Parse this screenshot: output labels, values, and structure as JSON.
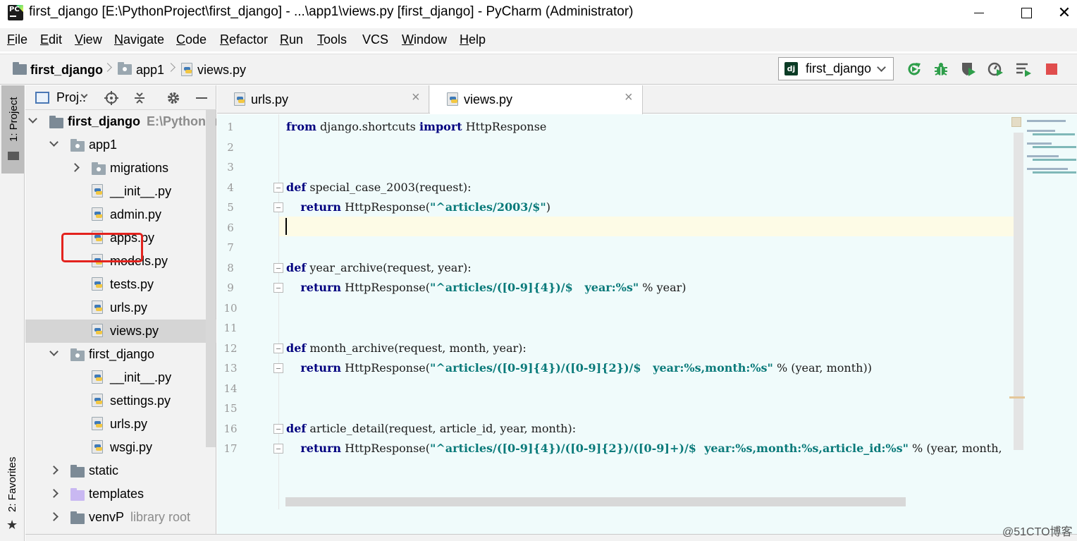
{
  "window": {
    "title": "first_django [E:\\PythonProject\\first_django] - ...\\app1\\views.py [first_django] - PyCharm (Administrator)",
    "app_icon_text": "PC",
    "close_glyph": "✕"
  },
  "menu": {
    "items": [
      {
        "mn": "F",
        "rest": "ile"
      },
      {
        "mn": "E",
        "rest": "dit"
      },
      {
        "mn": "V",
        "rest": "iew"
      },
      {
        "mn": "N",
        "rest": "avigate"
      },
      {
        "mn": "C",
        "rest": "ode"
      },
      {
        "mn": "R",
        "rest": "efactor"
      },
      {
        "mn": "R",
        "rest": "un"
      },
      {
        "mn": "T",
        "rest": "ools"
      },
      {
        "mn": "",
        "rest": "VCS"
      },
      {
        "mn": "W",
        "rest": "indow"
      },
      {
        "mn": "H",
        "rest": "elp"
      }
    ]
  },
  "breadcrumbs": [
    "first_django",
    "app1",
    "views.py"
  ],
  "run_config": {
    "icon_text": "dj",
    "label": "first_django"
  },
  "toolbar_icons": [
    "rerun-icon",
    "debug-icon",
    "coverage-icon",
    "profile-icon",
    "concurrency-icon",
    "stop-icon"
  ],
  "colors": {
    "accent_green": "#2e9e4a",
    "stop_red": "#e04d4d",
    "highlight_box": "#e3231e",
    "editor_bg": "#f0fbfb",
    "keyword": "#00007f",
    "string": "#0a7a7a"
  },
  "left_strip": {
    "project_tab": "1: Project",
    "favorites_tab": "2: Favorites"
  },
  "project_panel": {
    "view_label": "Proj..",
    "tree": [
      {
        "label": "first_django",
        "hint": "E:\\PythonPro",
        "icon": "folder-icon",
        "arrow": "open"
      },
      {
        "label": "app1",
        "hint": "",
        "icon": "package-icon",
        "arrow": "open"
      },
      {
        "label": "migrations",
        "hint": "",
        "icon": "package-icon",
        "arrow": "closed"
      },
      {
        "label": "__init__.py",
        "hint": "",
        "icon": "python-file-icon",
        "arrow": ""
      },
      {
        "label": "admin.py",
        "hint": "",
        "icon": "python-file-icon",
        "arrow": ""
      },
      {
        "label": "apps.py",
        "hint": "",
        "icon": "python-file-icon",
        "arrow": ""
      },
      {
        "label": "models.py",
        "hint": "",
        "icon": "python-file-icon",
        "arrow": ""
      },
      {
        "label": "tests.py",
        "hint": "",
        "icon": "python-file-icon",
        "arrow": ""
      },
      {
        "label": "urls.py",
        "hint": "",
        "icon": "python-file-icon",
        "arrow": ""
      },
      {
        "label": "views.py",
        "hint": "",
        "icon": "python-file-icon",
        "arrow": "",
        "selected": true
      },
      {
        "label": "first_django",
        "hint": "",
        "icon": "package-icon",
        "arrow": "open"
      },
      {
        "label": "__init__.py",
        "hint": "",
        "icon": "python-file-icon",
        "arrow": ""
      },
      {
        "label": "settings.py",
        "hint": "",
        "icon": "python-file-icon",
        "arrow": ""
      },
      {
        "label": "urls.py",
        "hint": "",
        "icon": "python-file-icon",
        "arrow": ""
      },
      {
        "label": "wsgi.py",
        "hint": "",
        "icon": "python-file-icon",
        "arrow": ""
      },
      {
        "label": "static",
        "hint": "",
        "icon": "folder-icon",
        "arrow": "closed"
      },
      {
        "label": "templates",
        "hint": "",
        "icon": "templates-folder-icon",
        "arrow": "closed"
      },
      {
        "label": "venvP",
        "hint": "library root",
        "icon": "folder-icon",
        "arrow": "closed"
      }
    ]
  },
  "editor": {
    "tabs": [
      {
        "label": "urls.py",
        "active": false
      },
      {
        "label": "views.py",
        "active": true
      }
    ],
    "tab_close_glyph": "×",
    "current_line": 6,
    "lines": [
      [
        {
          "t": "from",
          "c": "kw"
        },
        {
          "t": " django.shortcuts ",
          "c": ""
        },
        {
          "t": "import",
          "c": "kw"
        },
        {
          "t": " HttpResponse",
          "c": ""
        }
      ],
      [],
      [],
      [
        {
          "t": "def",
          "c": "kw"
        },
        {
          "t": " special_case_2003(request):",
          "c": ""
        }
      ],
      [
        {
          "t": "    ",
          "c": ""
        },
        {
          "t": "return",
          "c": "kw"
        },
        {
          "t": " HttpResponse(",
          "c": ""
        },
        {
          "t": "\"^articles/2003/$\"",
          "c": "str"
        },
        {
          "t": ")",
          "c": ""
        }
      ],
      [],
      [],
      [
        {
          "t": "def",
          "c": "kw"
        },
        {
          "t": " year_archive(request, year):",
          "c": ""
        }
      ],
      [
        {
          "t": "    ",
          "c": ""
        },
        {
          "t": "return",
          "c": "kw"
        },
        {
          "t": " HttpResponse(",
          "c": ""
        },
        {
          "t": "\"^articles/([0-9]{4})/$   year:%s\"",
          "c": "str"
        },
        {
          "t": " % year)",
          "c": ""
        }
      ],
      [],
      [],
      [
        {
          "t": "def",
          "c": "kw"
        },
        {
          "t": " month_archive(request, month, year):",
          "c": ""
        }
      ],
      [
        {
          "t": "    ",
          "c": ""
        },
        {
          "t": "return",
          "c": "kw"
        },
        {
          "t": " HttpResponse(",
          "c": ""
        },
        {
          "t": "\"^articles/([0-9]{4})/([0-9]{2})/$   year:%s,month:%s\"",
          "c": "str"
        },
        {
          "t": " % (year, month))",
          "c": ""
        }
      ],
      [],
      [],
      [
        {
          "t": "def",
          "c": "kw"
        },
        {
          "t": " article_detail(request, article_id, year, month):",
          "c": ""
        }
      ],
      [
        {
          "t": "    ",
          "c": ""
        },
        {
          "t": "return",
          "c": "kw"
        },
        {
          "t": " HttpResponse(",
          "c": ""
        },
        {
          "t": "\"^articles/([0-9]{4})/([0-9]{2})/([0-9]+)/$  year:%s,month:%s,article_id:%s\"",
          "c": "str"
        },
        {
          "t": " % (year, month,",
          "c": ""
        }
      ]
    ]
  },
  "watermark": "@51CTO博客"
}
